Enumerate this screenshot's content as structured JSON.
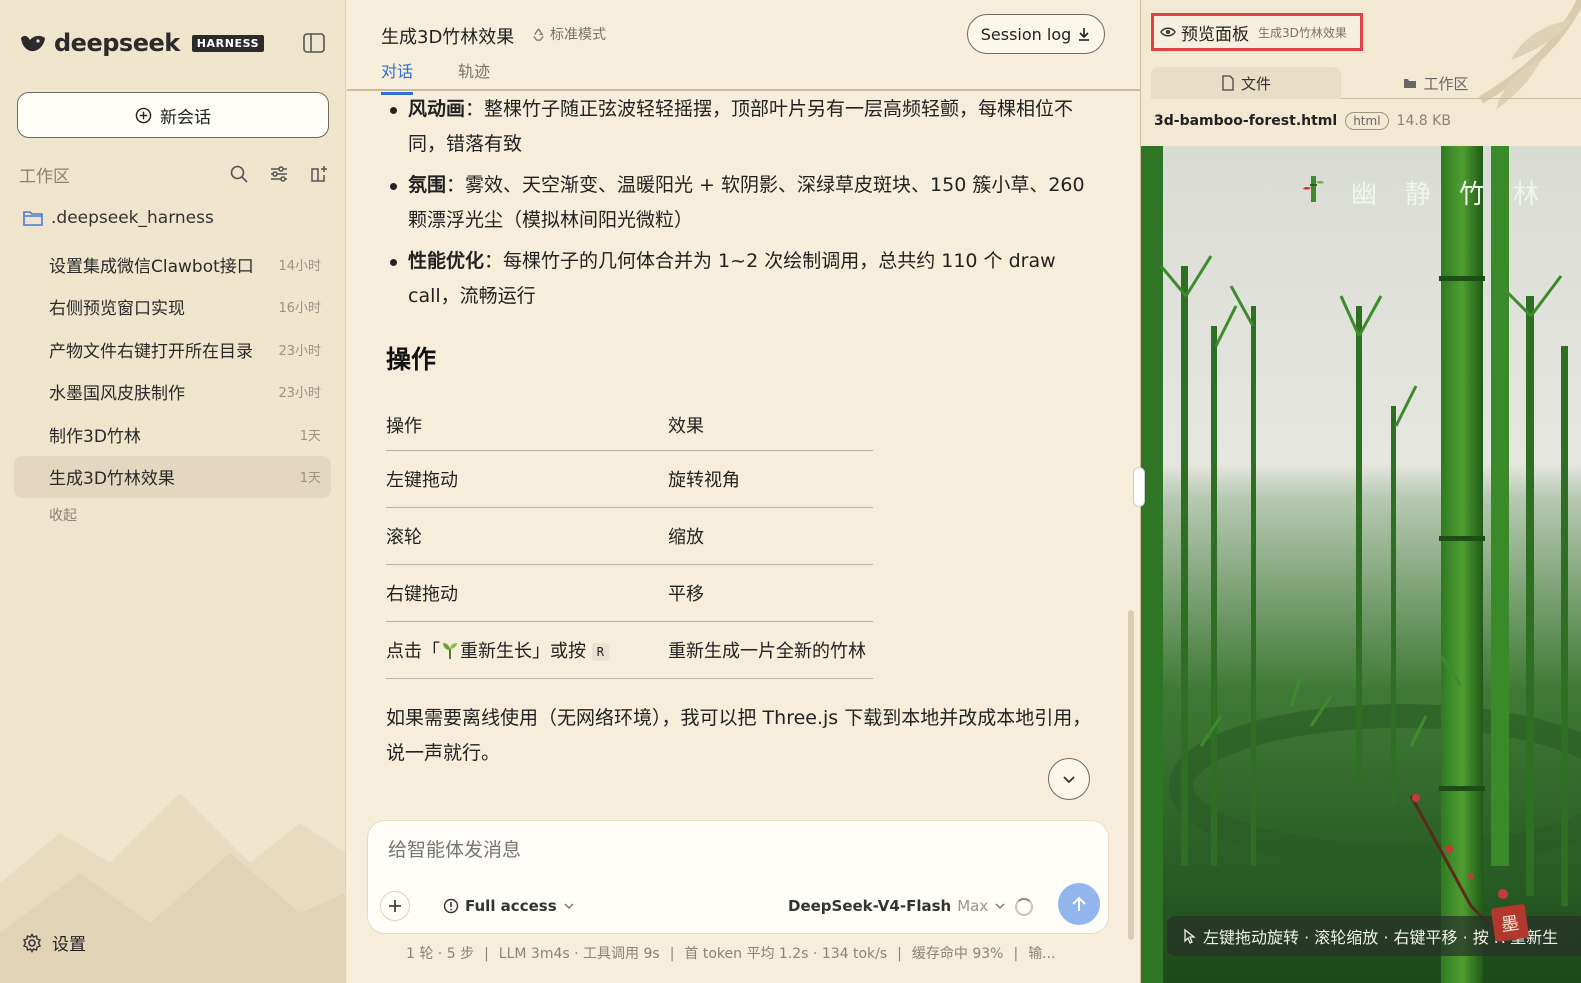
{
  "brand": {
    "name": "deepseek",
    "tag": "HARNESS"
  },
  "sidebar": {
    "new_chat": "新会话",
    "workspace_title": "工作区",
    "folder": ".deepseek_harness",
    "chats": [
      {
        "title": "设置集成微信Clawbot接口",
        "time": "14小时"
      },
      {
        "title": "右侧预览窗口实现",
        "time": "16小时"
      },
      {
        "title": "产物文件右键打开所在目录",
        "time": "23小时"
      },
      {
        "title": "水墨国风皮肤制作",
        "time": "23小时"
      },
      {
        "title": "制作3D竹林",
        "time": "1天"
      },
      {
        "title": "生成3D竹林效果",
        "time": "1天"
      }
    ],
    "collapse": "收起",
    "settings": "设置"
  },
  "chat": {
    "title": "生成3D竹林效果",
    "mode": "标准模式",
    "session_log": "Session log",
    "tabs": [
      "对话",
      "轨迹"
    ],
    "bullets": [
      {
        "label": "风动画",
        "text": "：整棵竹子随正弦波轻轻摇摆，顶部叶片另有一层高频轻颤，每棵相位不同，错落有致"
      },
      {
        "label": "氛围",
        "text": "：雾效、天空渐变、温暖阳光 + 软阴影、深绿草皮斑块、150 簇小草、260 颗漂浮光尘（模拟林间阳光微粒）"
      },
      {
        "label": "性能优化",
        "text": "：每棵竹子的几何体合并为 1~2 次绘制调用，总共约 110 个 draw call，流畅运行"
      }
    ],
    "section_title": "操作",
    "table": {
      "headers": [
        "操作",
        "效果"
      ],
      "rows": [
        {
          "op": "左键拖动",
          "effect": "旋转视角"
        },
        {
          "op": "滚轮",
          "effect": "缩放"
        },
        {
          "op": "右键拖动",
          "effect": "平移"
        }
      ],
      "last_row": {
        "op_prefix": "点击「",
        "op_label": "重新生长」或按",
        "key": "R",
        "effect": "重新生成一片全新的竹林"
      }
    },
    "paragraph": "如果需要离线使用（无网络环境），我可以把 Three.js 下载到本地并改成本地引用，说一声就行。",
    "composer": {
      "placeholder": "给智能体发消息",
      "access": "Full access",
      "model": "DeepSeek-V4-Flash",
      "model_level": "Max"
    },
    "stats": [
      "1 轮 · 5 步",
      "LLM 3m4s · 工具调用 9s",
      "首 token 平均 1.2s · 134 tok/s",
      "缓存命中 93%",
      "输..."
    ]
  },
  "preview": {
    "title": "预览面板",
    "subtitle": "生成3D竹林效果",
    "tabs": [
      "文件",
      "工作区"
    ],
    "file_name": "3d-bamboo-forest.html",
    "file_type": "html",
    "file_size": "14.8 KB",
    "scene_title": [
      "幽",
      "静",
      "竹",
      "林"
    ],
    "hint": "左键拖动旋转 · 滚轮缩放 · 右键平移 · 按 R 重新生",
    "seal": "墨"
  },
  "colors": {
    "accent": "#2f6fd6",
    "send": "#92b5ee",
    "highlight": "#e2414a",
    "paper": "#f3e9d3"
  }
}
